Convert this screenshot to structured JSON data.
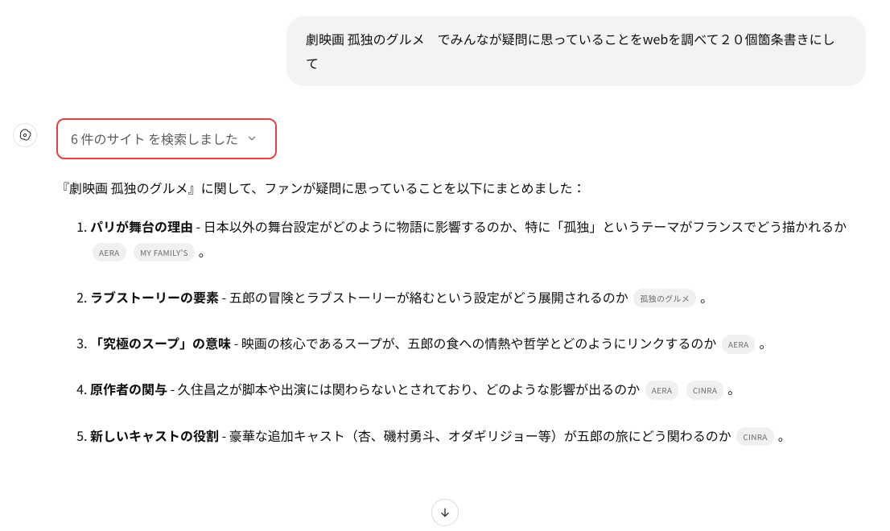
{
  "user_message": "劇映画 孤独のグルメ　でみんなが疑問に思っていることをwebを調べて２０個箇条書きにして",
  "search_status": "6 件のサイト を検索しました",
  "intro": "『劇映画 孤独のグルメ』に関して、ファンが疑問に思っていることを以下にまとめました：",
  "items": [
    {
      "title": "パリが舞台の理由",
      "body": " - 日本以外の舞台設定がどのように物語に影響するのか、特に「孤独」というテーマがフランスでどう描かれるか",
      "cites": [
        "AERA",
        "MY FAMILY'S"
      ]
    },
    {
      "title": "ラブストーリーの要素",
      "body": " - 五郎の冒険とラブストーリーが絡むという設定がどう展開されるのか",
      "cites": [
        "孤独のグルメ"
      ]
    },
    {
      "title": "「究極のスープ」の意味",
      "body": " - 映画の核心であるスープが、五郎の食への情熱や哲学とどのようにリンクするのか",
      "cites": [
        "AERA"
      ]
    },
    {
      "title": "原作者の関与",
      "body": " - 久住昌之が脚本や出演には関わらないとされており、どのような影響が出るのか",
      "cites": [
        "AERA",
        "CINRA"
      ]
    },
    {
      "title": "新しいキャストの役割",
      "body": " - 豪華な追加キャスト（杏、磯村勇斗、オダギリジョー等）が五郎の旅にどう関わるのか",
      "cites": [
        "CINRA"
      ]
    }
  ],
  "period": "。"
}
